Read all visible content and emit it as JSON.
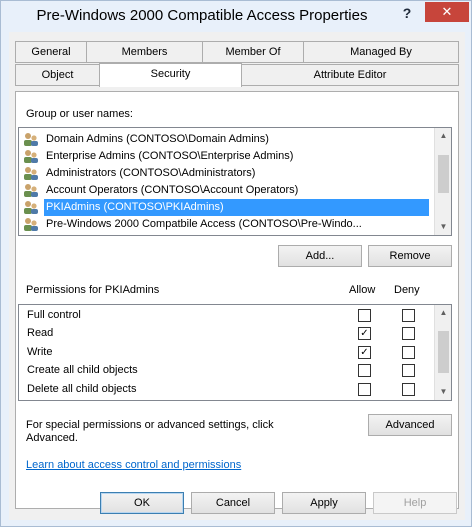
{
  "window": {
    "title": "Pre-Windows 2000 Compatible Access Properties",
    "help_glyph": "?",
    "close_glyph": "✕"
  },
  "tabs": {
    "row1": [
      {
        "label": "General"
      },
      {
        "label": "Members"
      },
      {
        "label": "Member Of"
      },
      {
        "label": "Managed By"
      }
    ],
    "row2": [
      {
        "label": "Object"
      },
      {
        "label": "Security"
      },
      {
        "label": "Attribute Editor"
      }
    ],
    "active": "Security"
  },
  "security": {
    "group_label": "Group or user names:",
    "users": [
      {
        "name": "Domain Admins (CONTOSO\\Domain Admins)",
        "selected": false
      },
      {
        "name": "Enterprise Admins (CONTOSO\\Enterprise Admins)",
        "selected": false
      },
      {
        "name": "Administrators (CONTOSO\\Administrators)",
        "selected": false
      },
      {
        "name": "Account Operators (CONTOSO\\Account Operators)",
        "selected": false
      },
      {
        "name": "PKIAdmins (CONTOSO\\PKIAdmins)",
        "selected": true
      },
      {
        "name": "Pre-Windows 2000 Compatbile Access (CONTOSO\\Pre-Windo...",
        "selected": false
      }
    ],
    "add_label": "Add...",
    "remove_label": "Remove",
    "permissions_for": "Permissions for PKIAdmins",
    "allow_header": "Allow",
    "deny_header": "Deny",
    "permissions": [
      {
        "name": "Full control",
        "allow": false,
        "deny": false
      },
      {
        "name": "Read",
        "allow": true,
        "deny": false
      },
      {
        "name": "Write",
        "allow": true,
        "deny": false
      },
      {
        "name": "Create all child objects",
        "allow": false,
        "deny": false
      },
      {
        "name": "Delete all child objects",
        "allow": false,
        "deny": false
      }
    ],
    "special_text_line1": "For special permissions or advanced settings, click",
    "special_text_line2": "Advanced.",
    "advanced_label": "Advanced",
    "learn_link": "Learn about access control and permissions"
  },
  "footer": {
    "ok_label": "OK",
    "cancel_label": "Cancel",
    "apply_label": "Apply",
    "help_label": "Help"
  },
  "colors": {
    "selection": "#3399ff",
    "close_button": "#c7453b",
    "link": "#0066cc"
  }
}
